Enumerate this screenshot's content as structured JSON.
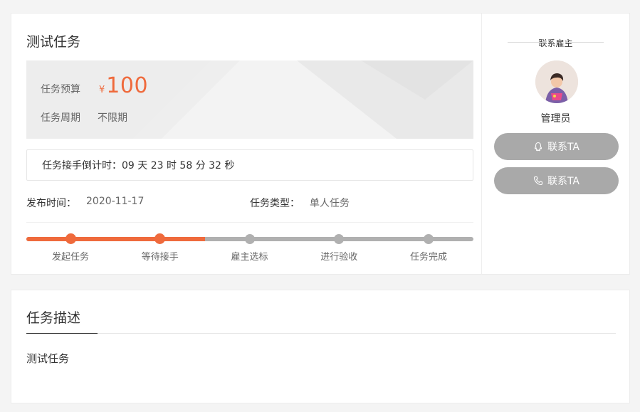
{
  "task": {
    "title": "测试任务",
    "budget_label": "任务预算",
    "budget_currency": "¥",
    "budget_amount": "100",
    "period_label": "任务周期",
    "period_value": "不限期",
    "countdown_text": "任务接手倒计时：09 天 23 时 58 分 32 秒",
    "publish_label": "发布时间：",
    "publish_value": "2020-11-17",
    "type_label": "任务类型：",
    "type_value": "单人任务",
    "progress": {
      "completed_steps": 2,
      "fill_fraction": 0.4,
      "steps": [
        "发起任务",
        "等待接手",
        "雇主选标",
        "进行验收",
        "任务完成"
      ]
    }
  },
  "contact": {
    "heading": "联系雇主",
    "name": "管理员",
    "qq_button": "联系TA",
    "phone_button": "联系TA"
  },
  "description": {
    "tab_title": "任务描述",
    "body": "测试任务"
  },
  "colors": {
    "accent": "#ef6a3c",
    "inactive": "#b0b0b0",
    "button": "#a9a9a9"
  },
  "icons": [
    "qq-icon",
    "phone-icon"
  ]
}
